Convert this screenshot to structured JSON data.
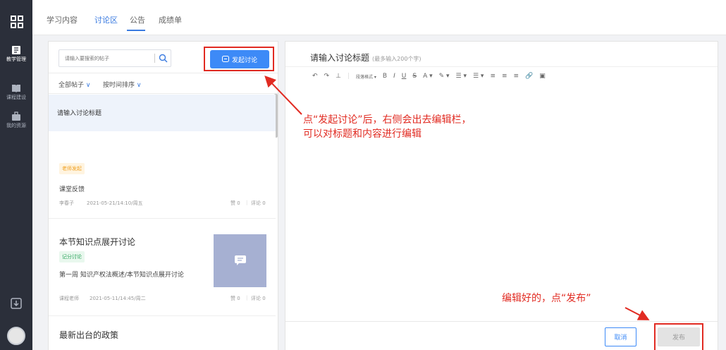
{
  "tabs": [
    {
      "label": "学习内容"
    },
    {
      "label": "讨论区"
    },
    {
      "label": "公告"
    },
    {
      "label": "成绩单"
    }
  ],
  "sidebar": {
    "items": [
      {
        "label": "教学管理",
        "icon": "teaching-icon"
      },
      {
        "label": "课程建设",
        "icon": "book-icon"
      },
      {
        "label": "我的资源",
        "icon": "briefcase-icon"
      }
    ]
  },
  "left": {
    "search": {
      "placeholder": "请输入要搜索的帖子"
    },
    "start_label": "发起讨论",
    "filters": [
      {
        "label": "全部帖子"
      },
      {
        "label": "按时间排序"
      }
    ],
    "draft_title": "请输入讨论标题",
    "posts": [
      {
        "badge": "老师发起",
        "title": "课堂反馈",
        "author": "李春子",
        "time": "2021-05-21/14:10/周五",
        "likes": "赞 0",
        "comments": "评论 0"
      },
      {
        "title": "本节知识点展开讨论",
        "badge": "记分讨论",
        "excerpt": "第一周 知识产权法概述/本节知识点展开讨论",
        "author": "课程老师",
        "time": "2021-05-11/14:45/周二",
        "likes": "赞 0",
        "comments": "评论 0"
      },
      {
        "title": "最新出台的政策"
      }
    ]
  },
  "editor": {
    "title_placeholder": "请输入讨论标题",
    "title_hint": "(最多输入200个字)",
    "toolbar": {
      "paragraph": "段落格式 ▾",
      "bold": "B",
      "italic": "I",
      "underline": "U",
      "strike": "S",
      "font_color": "A ▾",
      "highlight": "✎ ▾",
      "list1": "☰ ▾",
      "list2": "☰ ▾",
      "align_l": "≡",
      "align_c": "≡",
      "align_r": "≡",
      "link": "🔗",
      "image": "▣"
    },
    "cancel": "取消",
    "publish": "发布"
  },
  "annotations": {
    "line1": "点“发起讨论”后，右侧会出去编辑栏，",
    "line2": "可以对标题和内容进行编辑",
    "line3": "编辑好的，点“发布”"
  },
  "colors": {
    "accent": "#3d8af7",
    "annotation": "#e12b22",
    "sidebar": "#2b2f3a"
  }
}
